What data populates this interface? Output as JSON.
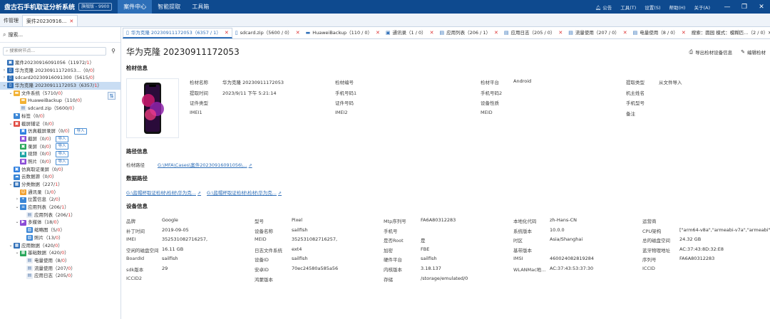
{
  "app": {
    "title": "盘古石手机取证分析系统",
    "version": "旗舰版 - 9900"
  },
  "nav": [
    "案件中心",
    "智能提取",
    "工具箱"
  ],
  "top_right": [
    "公告",
    "工具(T)",
    "设置(S)",
    "帮助(H)",
    "关于(A)"
  ],
  "win_controls": [
    "—",
    "❐",
    "✕"
  ],
  "tabs_l1": [
    {
      "label": "件管理"
    },
    {
      "label": "案件20230916...",
      "close": "✕"
    }
  ],
  "sidebar": {
    "search_label": "搜索...",
    "search_placeholder": "搜索树节点...",
    "tree": [
      {
        "level": 0,
        "tog": "",
        "icon": "case",
        "label": "案件20230916091056",
        "count": "11972",
        "red": "1",
        "badge": ""
      },
      {
        "level": 0,
        "tog": "›",
        "icon": "phone",
        "label": "华为克隆 20230911172053...",
        "count": "0",
        "red": "0",
        "badge": ""
      },
      {
        "level": 0,
        "tog": "›",
        "icon": "phone",
        "label": "sdcard20230916091300",
        "count": "5615",
        "red": "0",
        "badge": ""
      },
      {
        "level": 0,
        "tog": "⌄",
        "icon": "phone",
        "label": "华为克隆 20230911172053",
        "count": "6357",
        "red": "1",
        "badge": "",
        "sel": true
      },
      {
        "level": 1,
        "tog": "⌄",
        "icon": "folder",
        "label": "文件系统",
        "count": "5710",
        "red": "0",
        "badge": ""
      },
      {
        "level": 2,
        "tog": "",
        "icon": "folder",
        "label": "HuaweiBackup",
        "count": "110",
        "red": "0",
        "badge": ""
      },
      {
        "level": 2,
        "tog": "",
        "icon": "file",
        "label": "sdcard.zip",
        "count": "5600",
        "red": "0",
        "badge": ""
      },
      {
        "level": 1,
        "tog": "",
        "icon": "tag",
        "label": "标签",
        "count": "0",
        "red": "0",
        "badge": ""
      },
      {
        "level": 1,
        "tog": "⌄",
        "icon": "red",
        "label": "截屏辅证",
        "count": "0",
        "red": "0",
        "badge": ""
      },
      {
        "level": 2,
        "tog": "",
        "icon": "blue",
        "label": "仿真截屏录屏",
        "count": "0",
        "red": "0",
        "badge": "导入"
      },
      {
        "level": 2,
        "tog": "",
        "icon": "purple",
        "label": "截屏",
        "count": "0",
        "red": "0",
        "badge": "导入"
      },
      {
        "level": 2,
        "tog": "",
        "icon": "green",
        "label": "录屏",
        "count": "0",
        "red": "0",
        "badge": "导入"
      },
      {
        "level": 2,
        "tog": "",
        "icon": "teal",
        "label": "视频",
        "count": "0",
        "red": "0",
        "badge": "导入"
      },
      {
        "level": 2,
        "tog": "",
        "icon": "purple",
        "label": "照片",
        "count": "0",
        "red": "0",
        "badge": "导入"
      },
      {
        "level": 1,
        "tog": "",
        "icon": "blue",
        "label": "仿真取证录屏",
        "count": "0",
        "red": "0",
        "badge": ""
      },
      {
        "level": 1,
        "tog": "",
        "icon": "cloud",
        "label": "云数据源",
        "count": "0",
        "red": "0",
        "badge": ""
      },
      {
        "level": 1,
        "tog": "⌄",
        "icon": "grid",
        "label": "分类数据",
        "count": "227",
        "red": "1",
        "badge": ""
      },
      {
        "level": 2,
        "tog": "",
        "icon": "contact",
        "label": "通讯录",
        "count": "1",
        "red": "0",
        "badge": ""
      },
      {
        "level": 2,
        "tog": "›",
        "icon": "pin",
        "label": "位置信息",
        "count": "2",
        "red": "0",
        "badge": ""
      },
      {
        "level": 2,
        "tog": "⌄",
        "icon": "list",
        "label": "应用列表",
        "count": "206",
        "red": "1",
        "badge": ""
      },
      {
        "level": 3,
        "tog": "",
        "icon": "file",
        "label": "应用列表",
        "count": "206",
        "red": "1",
        "badge": ""
      },
      {
        "level": 2,
        "tog": "⌄",
        "icon": "media",
        "label": "多媒体",
        "count": "18",
        "red": "0",
        "badge": ""
      },
      {
        "level": 3,
        "tog": "",
        "icon": "img",
        "label": "缩略图",
        "count": "5",
        "red": "0",
        "badge": ""
      },
      {
        "level": 3,
        "tog": "",
        "icon": "img",
        "label": "照片",
        "count": "13",
        "red": "0",
        "badge": ""
      },
      {
        "level": 1,
        "tog": "⌄",
        "icon": "app",
        "label": "应用数据",
        "count": "420",
        "red": "0",
        "badge": ""
      },
      {
        "level": 2,
        "tog": "⌄",
        "icon": "app2",
        "label": "基础数据",
        "count": "420",
        "red": "0",
        "badge": ""
      },
      {
        "level": 3,
        "tog": "",
        "icon": "file",
        "label": "电量使用",
        "count": "8",
        "red": "0",
        "badge": ""
      },
      {
        "level": 3,
        "tog": "",
        "icon": "file",
        "label": "流量使用",
        "count": "207",
        "red": "0",
        "badge": ""
      },
      {
        "level": 3,
        "tog": "",
        "icon": "file",
        "label": "应用日志",
        "count": "205",
        "red": "0",
        "badge": ""
      }
    ]
  },
  "tabs_l2": [
    {
      "icon": "▯",
      "label": "华为克隆 20230911172053（6357 / 1）",
      "active": true
    },
    {
      "icon": "▯",
      "label": "sdcard.zip（5600 / 0）"
    },
    {
      "icon": "▬",
      "label": "HuaweiBackup（110 / 0）"
    },
    {
      "icon": "▣",
      "label": "通讯录（1 / 0）"
    },
    {
      "icon": "▤",
      "label": "应用列表（206 / 1）"
    },
    {
      "icon": "▤",
      "label": "应用日志（205 / 0）"
    },
    {
      "icon": "▤",
      "label": "流量使用（207 / 0）"
    },
    {
      "icon": "▤",
      "label": "电量使用（8 / 0）"
    }
  ],
  "tabs_l2_more": "搜索：圆园   模式：模糊匹...（2 / 0）✕  ›",
  "page": {
    "title": "华为克隆 20230911172053",
    "actions": [
      {
        "icon": "⎙",
        "label": "导出检材设备信息"
      },
      {
        "icon": "✎",
        "label": "编辑检材"
      }
    ],
    "sections": {
      "evidence": "检材信息",
      "path": "路径信息",
      "data_path": "数据路径",
      "device": "设备信息"
    }
  },
  "evidence": [
    {
      "label": "检材名称",
      "value": "华为克隆 20230911172053"
    },
    {
      "label": "提取时间",
      "value": "2023/9/11 下午 5:21:14"
    },
    {
      "label": "证件类型",
      "value": ""
    },
    {
      "label": "IMEI1",
      "value": ""
    },
    {
      "label": "检材编号",
      "value": ""
    },
    {
      "label": "手机号码1",
      "value": ""
    },
    {
      "label": "证件号码",
      "value": ""
    },
    {
      "label": "IMEI2",
      "value": ""
    },
    {
      "label": "检材平台",
      "value": "Android"
    },
    {
      "label": "手机号码2",
      "value": ""
    },
    {
      "label": "设备性质",
      "value": ""
    },
    {
      "label": "MEID",
      "value": ""
    },
    {
      "label": "提取类型",
      "value": "从文件导入"
    },
    {
      "label": "机主姓名",
      "value": ""
    },
    {
      "label": "手机型号",
      "value": ""
    },
    {
      "label": "备注",
      "value": ""
    }
  ],
  "path": {
    "label": "检材路径",
    "value": "G:\\MFA\\Cases\\案件20230916091056\\...",
    "ext": "⇗"
  },
  "data_paths": [
    {
      "value": "G:\\蓝帽杯取证检材\\检材\\华为克...",
      "ext": "⇗"
    },
    {
      "value": "G:\\蓝帽杯取证检材\\检材\\华为克...",
      "ext": "⇗"
    }
  ],
  "device": [
    [
      {
        "l": "品牌",
        "v": "Google"
      },
      {
        "l": "型号",
        "v": "Pixel"
      },
      {
        "l": "Mtp序列号",
        "v": "FA6A80312283"
      },
      {
        "l": "本地化代码",
        "v": "zh-Hans-CN"
      },
      {
        "l": "运营商",
        "v": ""
      }
    ],
    [
      {
        "l": "补丁时间",
        "v": "2019-09-05"
      },
      {
        "l": "设备名称",
        "v": "sailfish"
      },
      {
        "l": "手机号",
        "v": ""
      },
      {
        "l": "系统版本",
        "v": "10.0.0"
      },
      {
        "l": "CPU架构",
        "v": "[\"arm64-v8a\",\"armeabi-v7a\",\"armeabi\"]"
      }
    ],
    [
      {
        "l": "IMEI",
        "v": "352531082716257,"
      },
      {
        "l": "MEID",
        "v": "352531082716257,"
      },
      {
        "l": "是否Root",
        "v": "是"
      },
      {
        "l": "时区",
        "v": "Asia/Shanghai"
      },
      {
        "l": "总的磁盘空间",
        "v": "24.32 GB"
      }
    ],
    [
      {
        "l": "空闲的磁盘空间",
        "v": "16.11 GB"
      },
      {
        "l": "日志文件系统",
        "v": "ext4"
      },
      {
        "l": "加密",
        "v": "FBE"
      },
      {
        "l": "基带版本",
        "v": ""
      },
      {
        "l": "蓝牙物理地址",
        "v": "AC:37:43:8D:32:E8"
      }
    ],
    [
      {
        "l": "BoardId",
        "v": "sailfish"
      },
      {
        "l": "设备ID",
        "v": "sailfish"
      },
      {
        "l": "硬件平台",
        "v": "sailfish"
      },
      {
        "l": "IMSI",
        "v": "460024082819284"
      },
      {
        "l": "序列号",
        "v": "FA6A80312283"
      }
    ],
    [
      {
        "l": "sdk版本",
        "v": "29"
      },
      {
        "l": "安卓ID",
        "v": "70ec24580a585a56"
      },
      {
        "l": "内核版本",
        "v": "3.18.137"
      },
      {
        "l": "WLANMac地...",
        "v": "AC:37:43:53:37:30"
      },
      {
        "l": "ICCID",
        "v": ""
      }
    ],
    [
      {
        "l": "ICCID2",
        "v": ""
      },
      {
        "l": "鸿蒙版本",
        "v": ""
      },
      {
        "l": "存储",
        "v": "/storage/emulated/0"
      },
      {
        "l": "",
        "v": ""
      },
      {
        "l": "",
        "v": ""
      }
    ]
  ],
  "colors": {
    "titlebar": "#0e4a8f",
    "accent": "#2f6fb8",
    "red": "#dd3333"
  }
}
